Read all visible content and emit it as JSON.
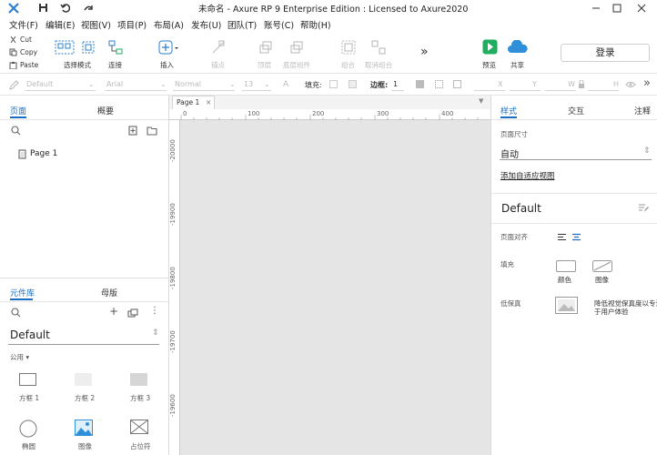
{
  "titlebar": {
    "title": "未命名 - Axure RP 9 Enterprise Edition : Licensed to Axure2020",
    "window_buttons": [
      "minimize",
      "maximize",
      "close"
    ]
  },
  "menubar": {
    "items": [
      "文件(F)",
      "编辑(E)",
      "视图(V)",
      "项目(P)",
      "布局(A)",
      "发布(U)",
      "团队(T)",
      "账号(C)",
      "帮助(H)"
    ]
  },
  "toolbar": {
    "cut": "Cut",
    "copy": "Copy",
    "paste": "Paste",
    "select_mode": "选择模式",
    "connect": "连接",
    "insert": "插入",
    "point": "锚点",
    "top": "顶层",
    "bottom": "底层组件",
    "group": "组合",
    "ungroup": "取消组合",
    "more": "»",
    "preview": "预览",
    "share": "共享",
    "login": "登录"
  },
  "formatbar": {
    "style": "Default",
    "font": "Arial",
    "weight": "Normal",
    "size": "13",
    "fill_label": "填充:",
    "border_label": "边框:",
    "border_value": "1",
    "x_label": "X",
    "y_label": "Y",
    "w_label": "W",
    "h_label": "H"
  },
  "pages_panel": {
    "tab_pages": "页面",
    "tab_outline": "概要",
    "pages": [
      "Page 1"
    ]
  },
  "library_panel": {
    "tab_library": "元件库",
    "tab_masters": "母版",
    "library_name": "Default",
    "category": "公用 ▾",
    "widgets": [
      "方框 1",
      "方框 2",
      "方框 3",
      "椭圆",
      "图像",
      "占位符"
    ]
  },
  "canvas": {
    "tab_label": "Page 1",
    "ruler_h_ticks": [
      "0",
      "100",
      "200",
      "300",
      "400"
    ],
    "ruler_v_ticks": [
      "-20000",
      "-19900",
      "-19800",
      "-19700",
      "-19600"
    ]
  },
  "inspector": {
    "tab_style": "样式",
    "tab_interactions": "交互",
    "tab_notes": "注释",
    "page_size_label": "页面尺寸",
    "page_size_value": "自动",
    "adaptive_link": "添加自适应视图",
    "style_name": "Default",
    "page_align_label": "页面对齐",
    "fill_label": "填充",
    "fill_color": "颜色",
    "fill_image": "图像",
    "low_fidelity_label": "低保真",
    "low_fidelity_desc_line1": "降低视觉保真度以专注",
    "low_fidelity_desc_line2": "于用户体验"
  },
  "colors": {
    "accent": "#1a6fc2",
    "canvas_bg": "#e5e5e5",
    "preview_green": "#1fae5f",
    "share_blue": "#2f8fd8"
  }
}
